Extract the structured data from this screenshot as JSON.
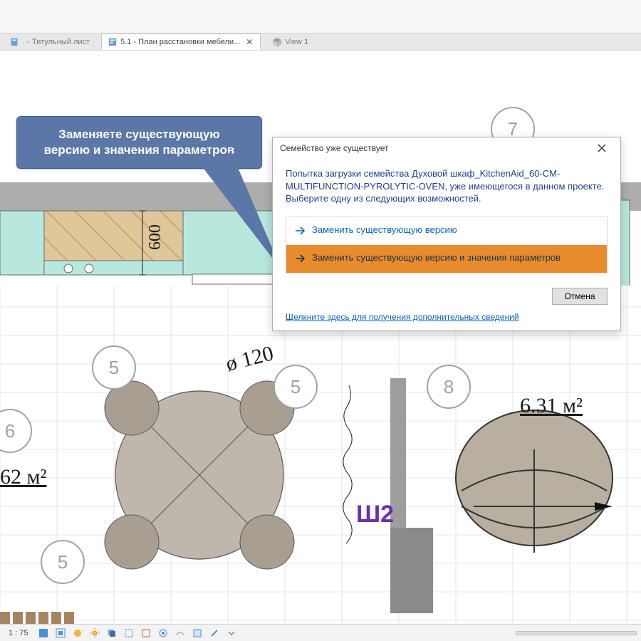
{
  "tabs": {
    "sheet": {
      "label": ". - Титульный лист"
    },
    "plan": {
      "label": "5.1 - План расстановки мебели..."
    },
    "view3d": {
      "label": "View 1"
    }
  },
  "callout": {
    "line1": "Заменяете существующую",
    "line2": "версию и значения параметров"
  },
  "dialog": {
    "title": "Семейство уже существует",
    "message": "Попытка загрузки семейства Духовой шкаф_KitchenAid_60-CM-MULTIFUNCTION-PYROLYTIC-OVEN, уже имеющегося в данном проекте.  Выберите одну из следующих возможностей.",
    "option1": "Заменить существующую версию",
    "option2": "Заменить существующую версию и значения параметров",
    "cancel": "Отмена",
    "help": "Щелкните здесь для получения дополнительных сведений"
  },
  "drawing": {
    "dim600": "600",
    "diam120": "ø 120",
    "area62": "62 м²",
    "area631": "6.31 м²",
    "roomSh2": "Ш2",
    "tag5a": "5",
    "tag5b": "5",
    "tag5c": "5",
    "tag6": "6",
    "tag7": "7",
    "tag8": "8"
  },
  "status": {
    "scale": "1 : 75"
  },
  "colors": {
    "teal": "#b7e7dd",
    "wood": "#e0c79a",
    "accent": "#e88b2d",
    "callout": "#5a77a8"
  }
}
